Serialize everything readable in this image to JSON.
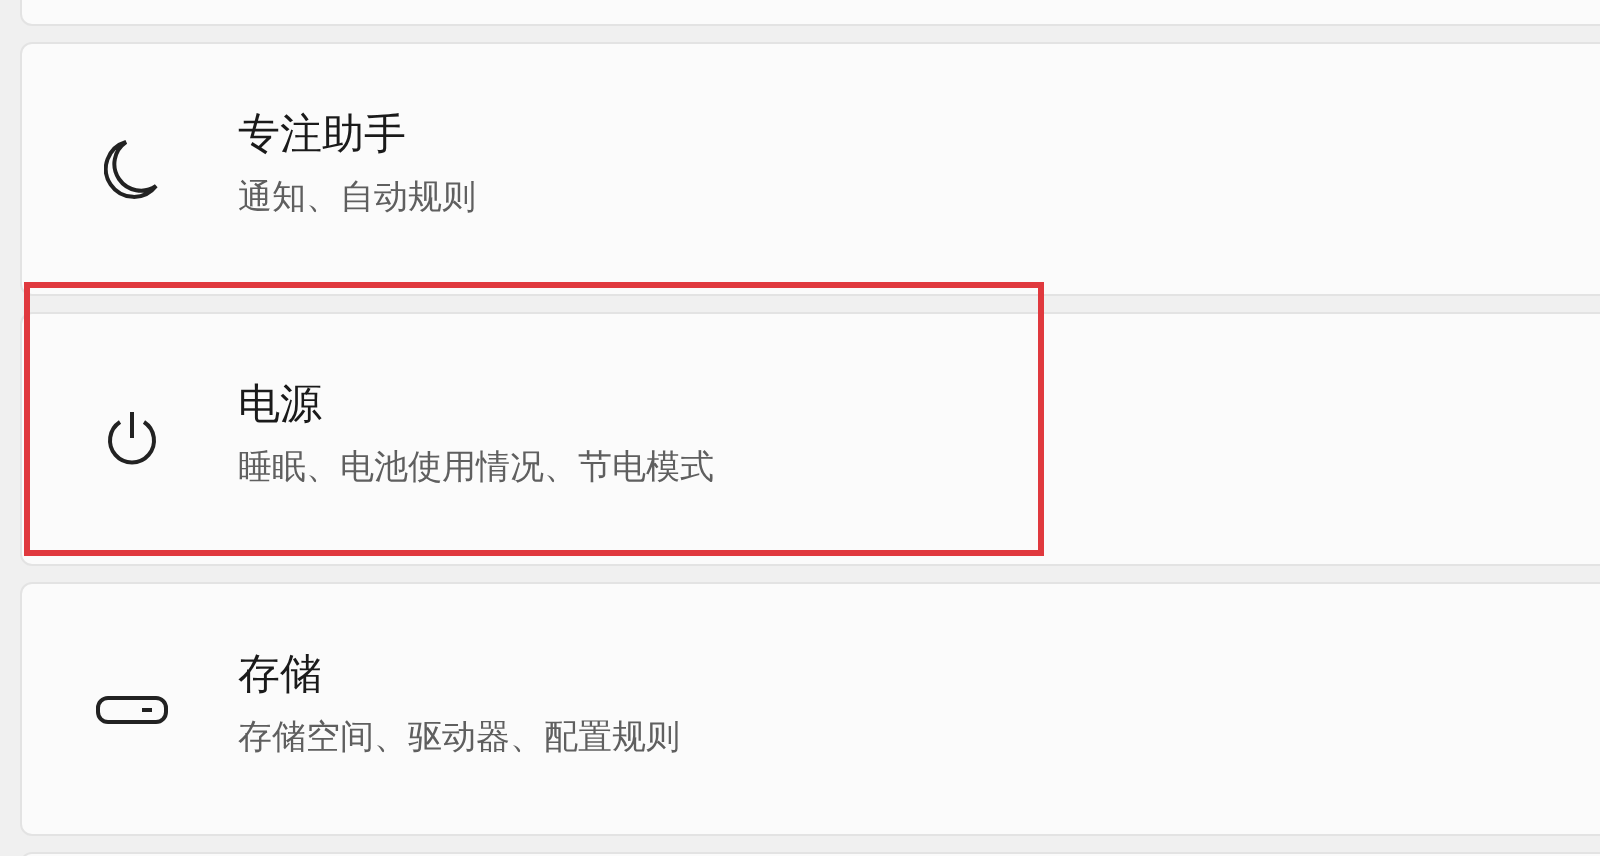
{
  "settings_items": [
    {
      "kind": "moon",
      "title": "专注助手",
      "subtitle": "通知、自动规则",
      "highlighted": false
    },
    {
      "kind": "power",
      "title": "电源",
      "subtitle": "睡眠、电池使用情况、节电模式",
      "highlighted": true
    },
    {
      "kind": "storage",
      "title": "存储",
      "subtitle": "存储空间、驱动器、配置规则",
      "highlighted": false
    }
  ]
}
